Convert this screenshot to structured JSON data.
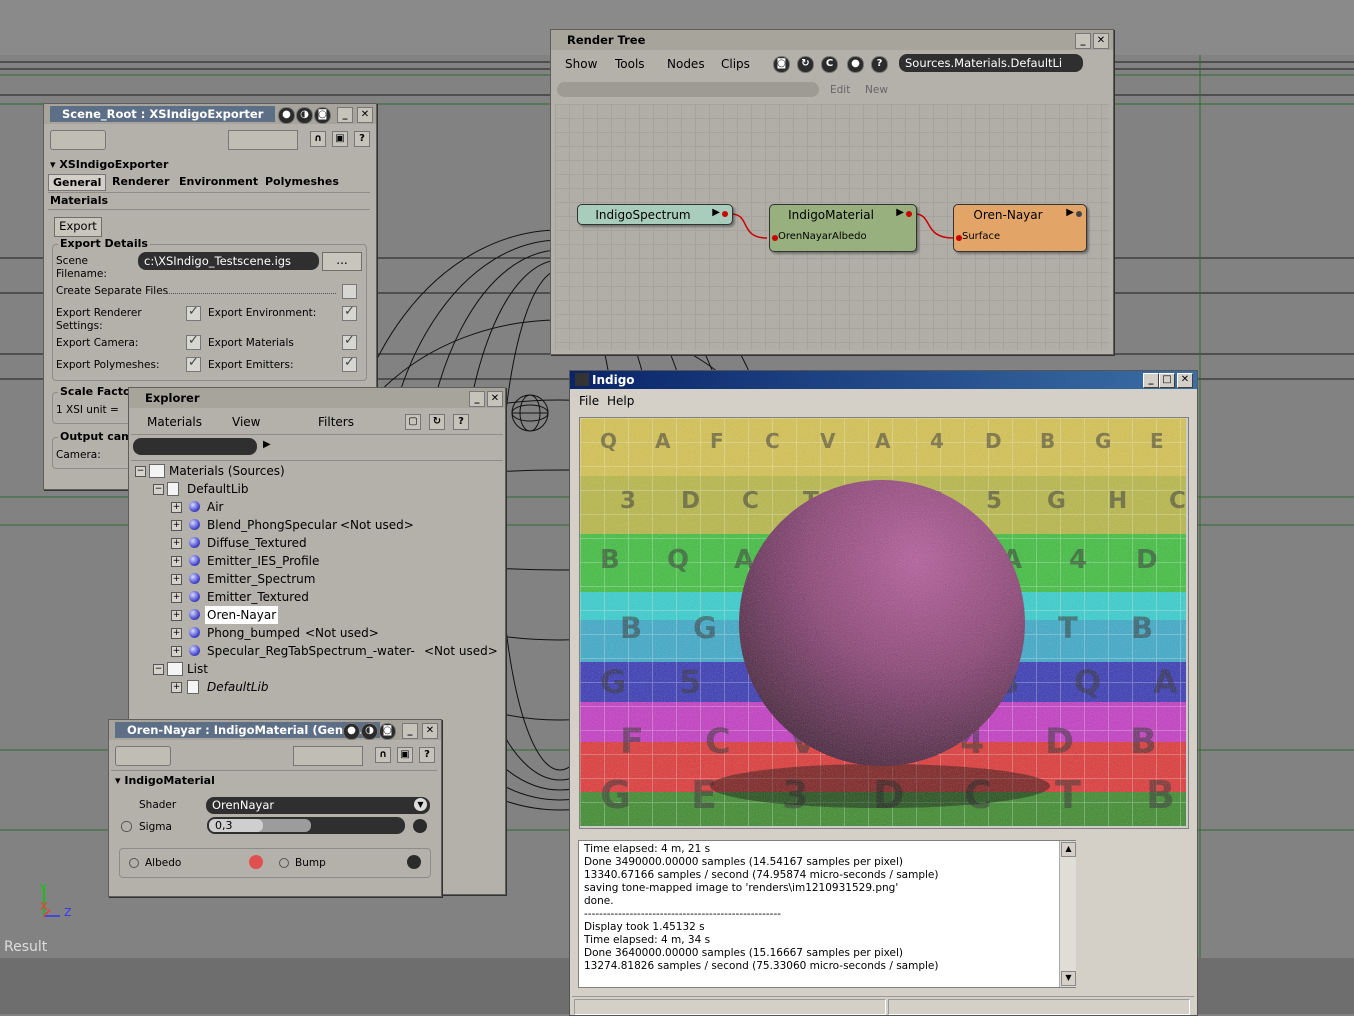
{
  "viewport": {
    "result_label": "Result",
    "axis": {
      "y": "Y",
      "x": "X",
      "z": "Z"
    }
  },
  "scene_panel": {
    "title": "Scene_Root : XSIndigoExporter",
    "section": "XSIndigoExporter",
    "tabs": [
      "General",
      "Renderer",
      "Environment",
      "Polymeshes"
    ],
    "tab2": "Materials",
    "export_button": "Export",
    "export_details": "Export Details",
    "scene_filename_label_1": "Scene",
    "scene_filename_label_2": "Filename:",
    "scene_filename_value": "c:\\XSIndigo_Testscene.igs",
    "browse_button": "...",
    "create_separate_files": "Create Separate Files",
    "export_renderer_settings_1": "Export Renderer",
    "export_renderer_settings_2": "Settings:",
    "export_environment": "Export Environment:",
    "export_camera": "Export Camera:",
    "export_materials": "Export Materials",
    "export_polymeshes": "Export Polymeshes:",
    "export_emitters": "Export Emitters:",
    "scale_factor": "Scale Factor",
    "xsi_unit": "1 XSI unit =",
    "output_camera": "Output cam",
    "camera_label": "Camera:"
  },
  "render_tree": {
    "title": "Render Tree",
    "menus": [
      "Show",
      "Tools",
      "Nodes",
      "Clips"
    ],
    "path_value": "Sources.Materials.DefaultLi",
    "edit": "Edit",
    "new": "New",
    "nodes": {
      "spectrum": {
        "title": "IndigoSpectrum",
        "color": "#a9cdbc"
      },
      "material": {
        "title": "IndigoMaterial",
        "port": "OrenNayarAlbedo",
        "color": "#97b07d"
      },
      "orennayar": {
        "title": "Oren-Nayar",
        "port": "Surface",
        "color": "#e3a467"
      }
    }
  },
  "explorer": {
    "title": "Explorer",
    "menus": [
      "Materials",
      "View",
      "Filters"
    ],
    "root": "Materials (Sources)",
    "library": "DefaultLib",
    "items": [
      {
        "name": "Air",
        "note": ""
      },
      {
        "name": "Blend_PhongSpecular",
        "note": "<Not used>"
      },
      {
        "name": "Diffuse_Textured",
        "note": ""
      },
      {
        "name": "Emitter_IES_Profile",
        "note": ""
      },
      {
        "name": "Emitter_Spectrum",
        "note": ""
      },
      {
        "name": "Emitter_Textured",
        "note": ""
      },
      {
        "name": "Oren-Nayar",
        "note": ""
      },
      {
        "name": "Phong_bumped",
        "note": "<Not used>"
      },
      {
        "name": "Specular_RegTabSpectrum_-water-",
        "note": "<Not used>"
      }
    ],
    "list": "List",
    "list_item": "DefaultLib"
  },
  "material_panel": {
    "title": "Oren-Nayar : IndigoMaterial (Gener...",
    "section": "IndigoMaterial",
    "shader_label": "Shader",
    "shader_value": "OrenNayar",
    "sigma_label": "Sigma",
    "sigma_value": "0,3",
    "sigma_level": 0.3,
    "albedo_label": "Albedo",
    "bump_label": "Bump"
  },
  "indigo": {
    "title": "Indigo",
    "menu": [
      "File",
      "Help"
    ],
    "log": [
      "Time elapsed: 4 m, 21 s",
      "Done 3490000.00000 samples (14.54167 samples per pixel)",
      "13340.67166 samples / second (74.95874 micro-seconds / sample)",
      "saving tone-mapped image to 'renders\\im1210931529.png'",
      "done.",
      "----------------------------------------------------",
      "Display took 1.45132 s",
      "Time elapsed: 4 m, 34 s",
      "Done 3640000.00000 samples (15.16667 samples per pixel)",
      "13274.81826 samples / second (75.33060 micro-seconds / sample)"
    ],
    "render_letters": [
      "Q",
      "A",
      "F",
      "C",
      "V",
      "A",
      "4",
      "D",
      "B",
      "G",
      "E",
      "3",
      "D",
      "C",
      "T",
      "B",
      "G",
      "5",
      "G",
      "H",
      "C",
      "B"
    ]
  }
}
